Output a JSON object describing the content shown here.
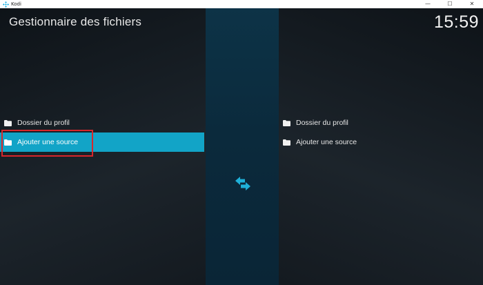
{
  "window": {
    "app_title": "Kodi",
    "controls": {
      "minimize": "—",
      "maximize": "☐",
      "close": "✕"
    }
  },
  "header": {
    "title": "Gestionnaire des fichiers",
    "clock": "15:59"
  },
  "left_list": {
    "items": [
      {
        "label": "Dossier du profil",
        "icon": "folder-icon",
        "selected": false
      },
      {
        "label": "Ajouter une source",
        "icon": "folder-icon",
        "selected": true
      }
    ]
  },
  "right_list": {
    "items": [
      {
        "label": "Dossier du profil",
        "icon": "folder-icon",
        "selected": false
      },
      {
        "label": "Ajouter une source",
        "icon": "folder-icon",
        "selected": false
      }
    ]
  },
  "center": {
    "icon": "swap-arrows-icon"
  },
  "colors": {
    "selection": "#12a4c7",
    "center_strip": "#0b2a3c",
    "annotation": "#d8262b",
    "swap_icon": "#1fb0d8"
  }
}
